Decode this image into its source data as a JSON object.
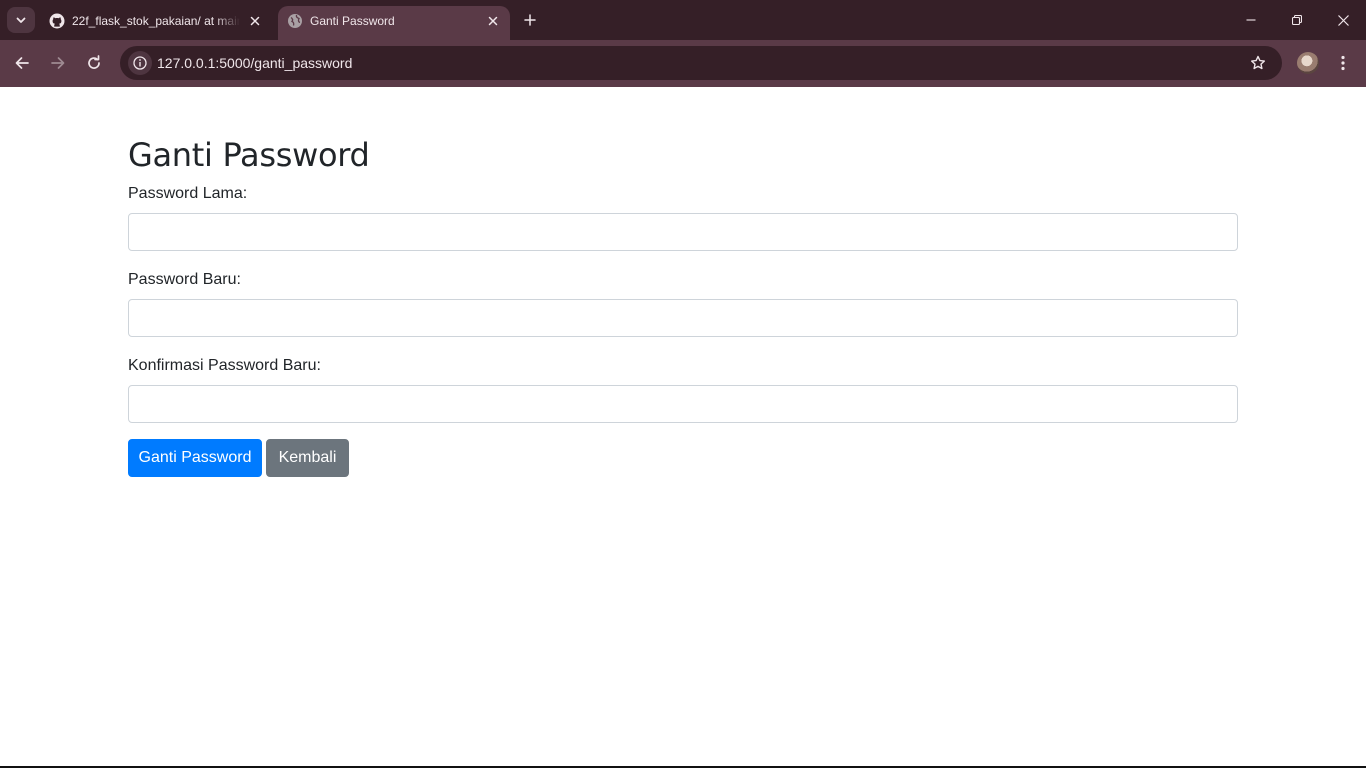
{
  "browser": {
    "tabs": [
      {
        "title": "22f_flask_stok_pakaian/ at main",
        "favicon": "github-icon",
        "active": false
      },
      {
        "title": "Ganti Password",
        "favicon": "globe-icon",
        "active": true
      }
    ],
    "url": "127.0.0.1:5000/ganti_password",
    "colors": {
      "tabbar": "#351f27",
      "toolbar": "#5a3a47"
    }
  },
  "page": {
    "heading": "Ganti Password",
    "fields": [
      {
        "label": "Password Lama:",
        "value": "",
        "placeholder": ""
      },
      {
        "label": "Password Baru:",
        "value": "",
        "placeholder": ""
      },
      {
        "label": "Konfirmasi Password Baru:",
        "value": "",
        "placeholder": ""
      }
    ],
    "buttons": {
      "submit": "Ganti Password",
      "back": "Kembali"
    },
    "colors": {
      "primary": "#007bff",
      "secondary": "#6c757d",
      "text": "#212529"
    }
  }
}
